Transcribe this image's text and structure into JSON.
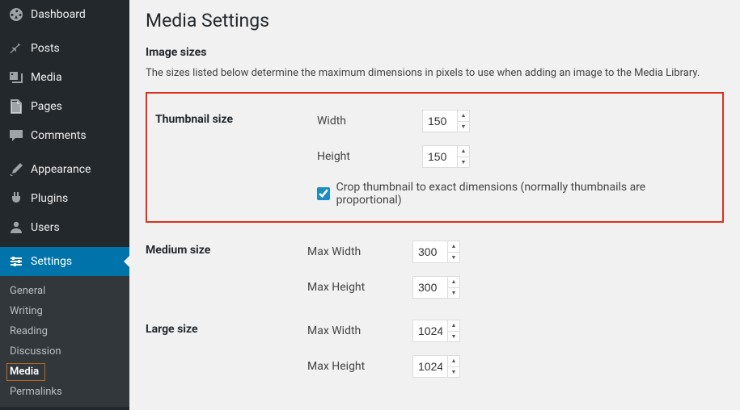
{
  "sidebar": {
    "items": [
      {
        "id": "dashboard",
        "label": "Dashboard",
        "icon": "dashboard-icon"
      },
      {
        "id": "posts",
        "label": "Posts",
        "icon": "pin-icon"
      },
      {
        "id": "media",
        "label": "Media",
        "icon": "media-icon"
      },
      {
        "id": "pages",
        "label": "Pages",
        "icon": "pages-icon"
      },
      {
        "id": "comments",
        "label": "Comments",
        "icon": "comment-icon"
      },
      {
        "id": "appearance",
        "label": "Appearance",
        "icon": "brush-icon"
      },
      {
        "id": "plugins",
        "label": "Plugins",
        "icon": "plug-icon"
      },
      {
        "id": "users",
        "label": "Users",
        "icon": "user-icon"
      },
      {
        "id": "settings",
        "label": "Settings",
        "icon": "sliders-icon",
        "current": true
      }
    ],
    "submenu": [
      {
        "id": "general",
        "label": "General"
      },
      {
        "id": "writing",
        "label": "Writing"
      },
      {
        "id": "reading",
        "label": "Reading"
      },
      {
        "id": "discussion",
        "label": "Discussion"
      },
      {
        "id": "media",
        "label": "Media",
        "current": true
      },
      {
        "id": "permalinks",
        "label": "Permalinks"
      }
    ]
  },
  "page": {
    "title": "Media Settings",
    "section_title": "Image sizes",
    "description": "The sizes listed below determine the maximum dimensions in pixels to use when adding an image to the Media Library."
  },
  "settings": {
    "thumbnail": {
      "heading": "Thumbnail size",
      "width_label": "Width",
      "width_value": "150",
      "height_label": "Height",
      "height_value": "150",
      "crop_checked": true,
      "crop_label": "Crop thumbnail to exact dimensions (normally thumbnails are proportional)"
    },
    "medium": {
      "heading": "Medium size",
      "width_label": "Max Width",
      "width_value": "300",
      "height_label": "Max Height",
      "height_value": "300"
    },
    "large": {
      "heading": "Large size",
      "width_label": "Max Width",
      "width_value": "1024",
      "height_label": "Max Height",
      "height_value": "1024"
    }
  }
}
